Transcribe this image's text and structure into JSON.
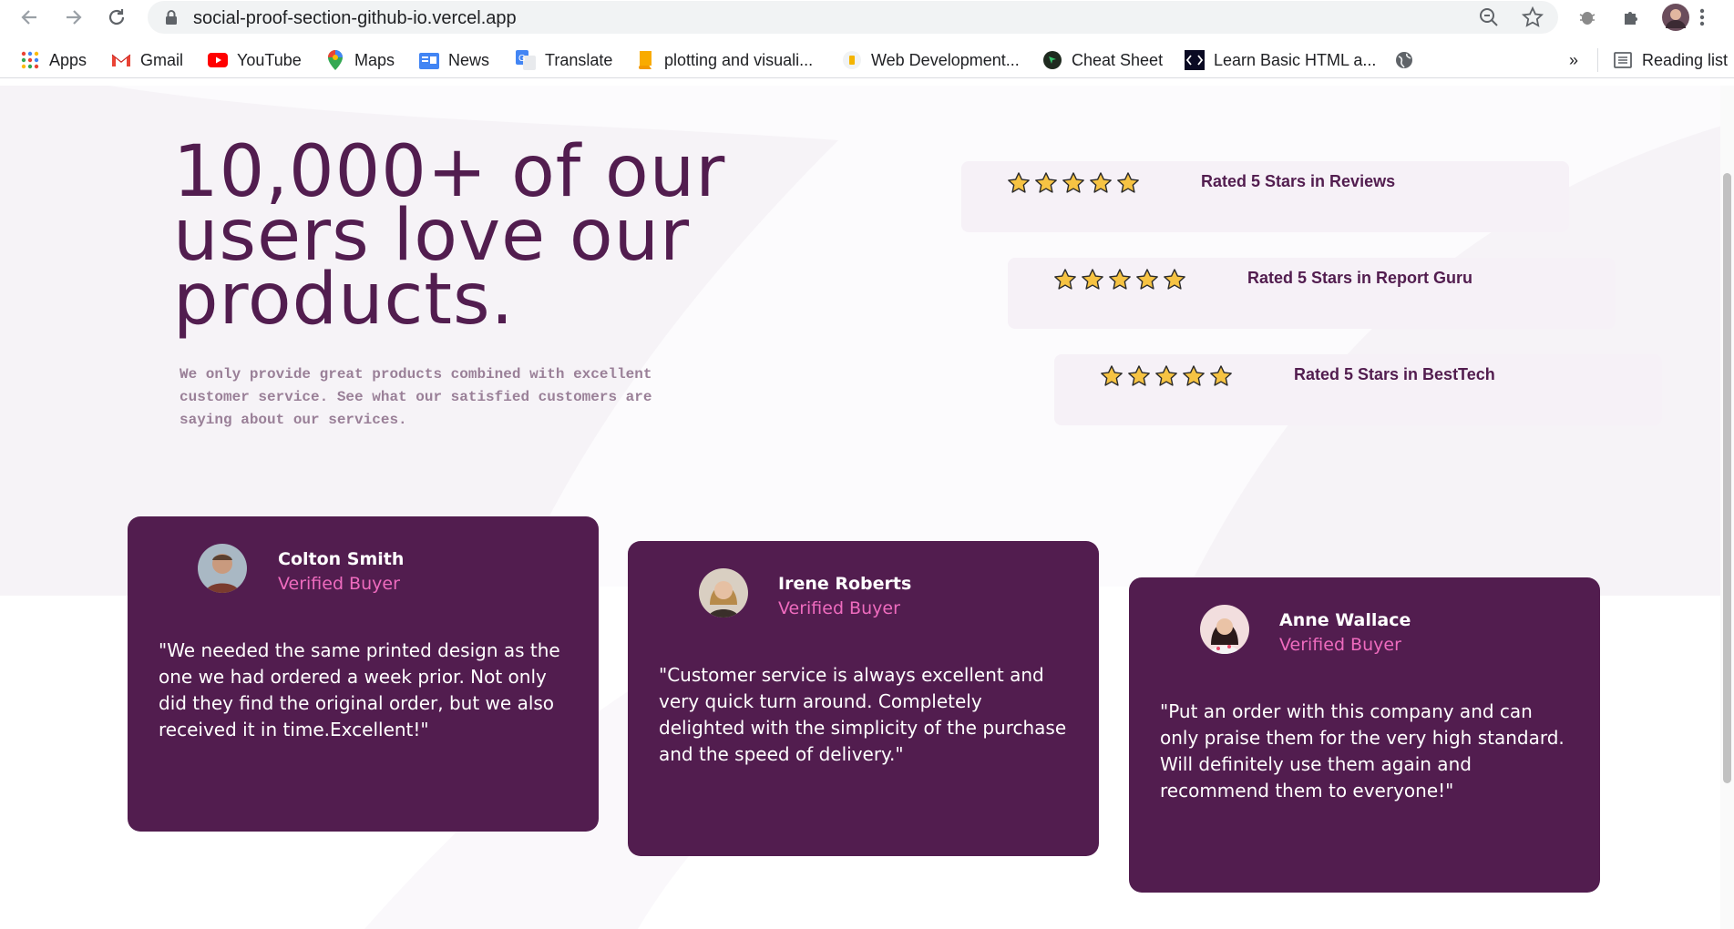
{
  "browser": {
    "url": "social-proof-section-github-io.vercel.app",
    "bookmarks": [
      {
        "label": "Apps",
        "icon": "apps-grid-icon"
      },
      {
        "label": "Gmail",
        "icon": "gmail-icon"
      },
      {
        "label": "YouTube",
        "icon": "youtube-icon"
      },
      {
        "label": "Maps",
        "icon": "maps-icon"
      },
      {
        "label": "News",
        "icon": "news-icon"
      },
      {
        "label": "Translate",
        "icon": "translate-icon"
      },
      {
        "label": "plotting and visuali...",
        "icon": "book-icon"
      },
      {
        "label": "Web Development...",
        "icon": "web-dev-icon"
      },
      {
        "label": "Cheat Sheet",
        "icon": "cheat-sheet-icon"
      },
      {
        "label": "Learn Basic HTML a...",
        "icon": "code-icon"
      }
    ],
    "overflow_label": "»",
    "reading_list": "Reading list"
  },
  "hero": {
    "headline": "10,000+ of our users love our products.",
    "intro": "We only provide great products combined with excellent customer service. See what our satisfied customers are saying about our services."
  },
  "ratings": [
    {
      "stars": 5,
      "label": "Rated 5 Stars in Reviews"
    },
    {
      "stars": 5,
      "label": "Rated 5 Stars in Report Guru"
    },
    {
      "stars": 5,
      "label": "Rated 5 Stars in BestTech"
    }
  ],
  "testimonials": [
    {
      "name": "Colton Smith",
      "role": "Verified Buyer",
      "quote": "\"We needed the same printed design as the one we had ordered a week prior. Not only did they find the original order, but we also received it in time.Excellent!\""
    },
    {
      "name": "Irene Roberts",
      "role": "Verified Buyer",
      "quote": "\"Customer service is always excellent and very quick turn around. Completely delighted with the simplicity of the purchase and the speed of delivery.\""
    },
    {
      "name": "Anne Wallace",
      "role": "Verified Buyer",
      "quote": "\"Put an order with this company and can only praise them for the very high standard. Will definitely use them again and recommend them to everyone!\""
    }
  ],
  "colors": {
    "primary": "#521d4f",
    "accent": "#ee6bbe",
    "rating_bg": "#f6f1f7",
    "star": "#f6c343"
  }
}
